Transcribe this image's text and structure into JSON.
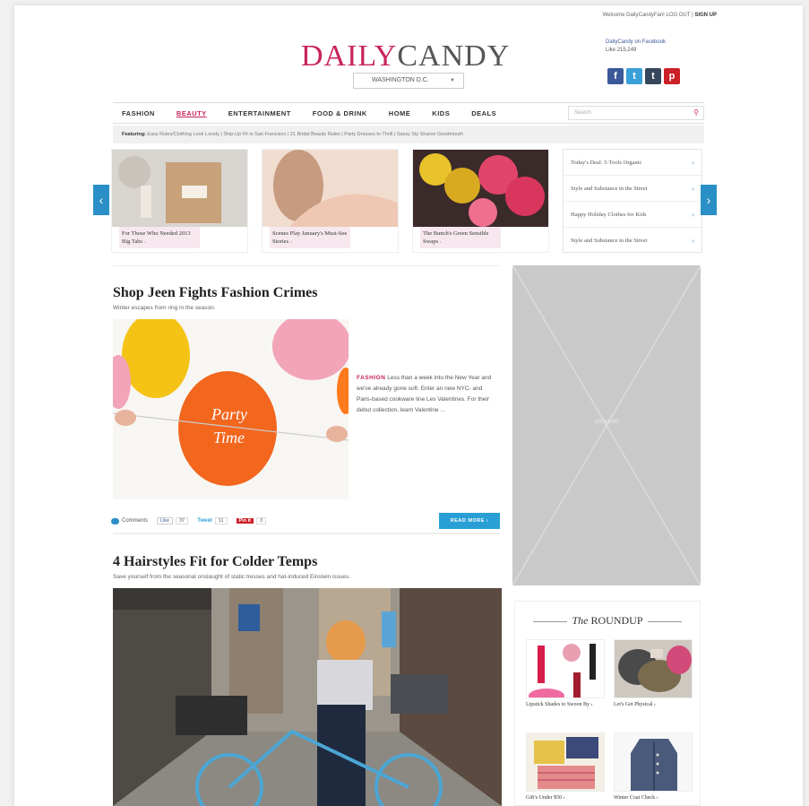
{
  "topbar": {
    "welcome": "Welcome DailyCandyFan!",
    "log_out": "LOG OUT",
    "sep": "|",
    "sign_up": "SIGN UP"
  },
  "header": {
    "logo_part1": "DAILY",
    "logo_part2": "CANDY",
    "city": "WASHINGTON D.C.",
    "facebook_title": "DailyCandy on Facebook",
    "like_label": "Like",
    "like_count": "215,249"
  },
  "social": [
    "f",
    "t",
    "t",
    "p"
  ],
  "nav": {
    "items": [
      "FASHION",
      "BEAUTY",
      "ENTERTAINMENT",
      "FOOD & DRINK",
      "HOME",
      "KIDS",
      "DEALS"
    ],
    "active": "BEAUTY",
    "search_placeholder": "Search"
  },
  "featuring": {
    "label": "Featuring:",
    "links": [
      "Easy Rules/Clothing Look Lovely",
      "Ship-Up Fit in San Francisco",
      "21 Bridal Beauty Rules",
      "Party Dresses to Thrill",
      "Sassy Sty Sharon Goodmouth"
    ]
  },
  "carousel": {
    "cards": [
      {
        "caption": "For Those Who Needed 2013 Big Tabs",
        "arrow": "›"
      },
      {
        "caption": "Scenes Play January's Must-See Stories",
        "arrow": "›"
      },
      {
        "caption": "The Bunch's Green Sensible Swaps",
        "arrow": "›"
      }
    ],
    "side_links": [
      "Today's Deal: 5-Tools Organic",
      "Style and Substance in the Street",
      "Happy Holiday Clothes for Kids",
      "Style and Substance in the Street"
    ],
    "side_arrow": "›",
    "prev": "‹",
    "next": "›"
  },
  "article1": {
    "title": "Shop Jeen Fights Fashion Crimes",
    "subtitle": "Winter escapes from ring in the season.",
    "tag": "FASHION",
    "excerpt": "Less than a week into the New Year and we've already gone soft. Enter an new NYC- and Paris-based cookware line Les Valentines. For their debut collection, learn Valentine ...",
    "comments_label": "Comments",
    "like_label": "Like",
    "like_count": "37",
    "tweet_label": "Tweet",
    "tweet_count": "11",
    "pin_label": "Pin it",
    "pin_count": "3",
    "read_more": "READ MORE ›",
    "balloon_text1": "Party",
    "balloon_text2": "Time"
  },
  "article2": {
    "title": "4 Hairstyles Fit for Colder Temps",
    "subtitle": "Save yourself from the seasonal onslaught of static tresses and hat-induced Einstein issues."
  },
  "ad": {
    "label": "300x600"
  },
  "roundup": {
    "title_the": "The",
    "title_main": "ROUNDUP",
    "items": [
      "Lipstick Shades to Swoon By ›",
      "Let's Get Physical ›",
      "Gift's Under $50 ›",
      "Winter Coat Check ›"
    ]
  },
  "colors": {
    "brand_pink": "#c8235a",
    "accent_blue": "#2a8fc6"
  }
}
